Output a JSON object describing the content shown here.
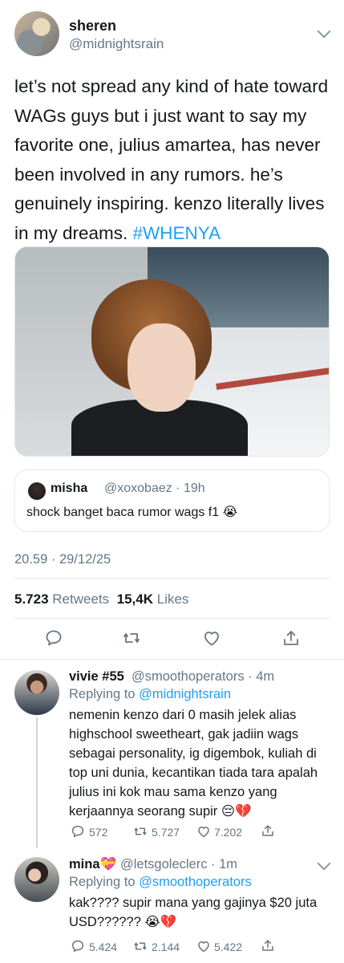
{
  "tweet": {
    "author_name": "sheren",
    "author_handle": "@midnightsrain",
    "text": "let’s not spread any kind of hate toward WAGs guys but i just want to say my favorite one, julius amartea, has never been involved in any rumors. he’s genuinely inspiring. kenzo literally lives in my dreams. ",
    "hashtag": "#WHENYA",
    "timestamp": "20.59 · 29/12/25",
    "retweets": "5.723",
    "retweets_label": "Retweets",
    "likes": "15,4K",
    "likes_label": "Likes"
  },
  "quoted": {
    "name": "misha",
    "handle": "@xoxobaez · 19h",
    "text": "shock banget baca rumor wags f1 😭"
  },
  "actions": {
    "icons": [
      "reply-icon",
      "retweet-icon",
      "like-icon",
      "share-icon"
    ]
  },
  "replies": [
    {
      "name": "vivie #55",
      "handle": "@smoothoperators · 4m",
      "replying_prefix": "Replying to ",
      "replying_to": "@midnightsrain",
      "text": "nemenin kenzo dari 0 masih jelek alias highschool sweetheart, gak jadiin wags sebagai personality, ig digembok, kuliah di top uni dunia, kecantikan tiada tara apalah julius ini kok mau sama kenzo yang kerjaannya seorang supir 😔💔",
      "replies": "572",
      "retweets": "5.727",
      "likes": "7.202"
    },
    {
      "name": "mina💝",
      "handle": "@letsgoleclerc · 1m",
      "replying_prefix": "Replying to ",
      "replying_to": "@smoothoperators",
      "text": "kak???? supir mana yang gajinya $20 juta USD?????? 😭💔",
      "replies": "5.424",
      "retweets": "2.144",
      "likes": "5.422"
    }
  ],
  "colors": {
    "accent": "#1da1f2",
    "secondary_text": "#657786",
    "border": "#e1e8ed"
  }
}
